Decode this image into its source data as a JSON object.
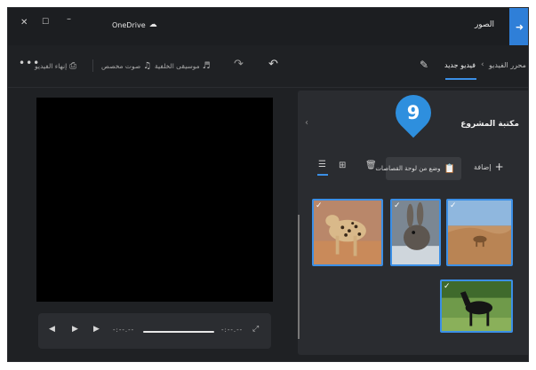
{
  "window": {
    "close_glyph": "✕",
    "maximize_glyph": "☐",
    "minimize_glyph": "–",
    "onedrive_label": "OneDrive",
    "app_name": "الصور",
    "back_icon": "arrow-right-icon"
  },
  "toolbar": {
    "more": "•••",
    "end_video_label": "إنهاء الفيديو",
    "custom_audio_label": "صوت مخصص",
    "background_music_label": "موسيقى الخلفية",
    "breadcrumb_root": "محرر الفيديو",
    "breadcrumb_current": "فيديو جديد"
  },
  "player": {
    "start_time": "-:--.--",
    "end_time": "-:--.--",
    "progress": 0
  },
  "library": {
    "title": "مكتبة المشروع",
    "add_label": "إضافة",
    "paste_label": "وضع من لوحة القصاصات",
    "items": [
      {
        "name": "leopard",
        "selected": true
      },
      {
        "name": "rabbit",
        "selected": true
      },
      {
        "name": "desert-camel",
        "selected": true
      },
      {
        "name": "horse",
        "selected": true
      }
    ]
  },
  "step_badge": "9",
  "colors": {
    "accent": "#3b8fe6",
    "badge": "#2e8fde",
    "background": "#1f2124",
    "panel": "#2a2c30"
  }
}
